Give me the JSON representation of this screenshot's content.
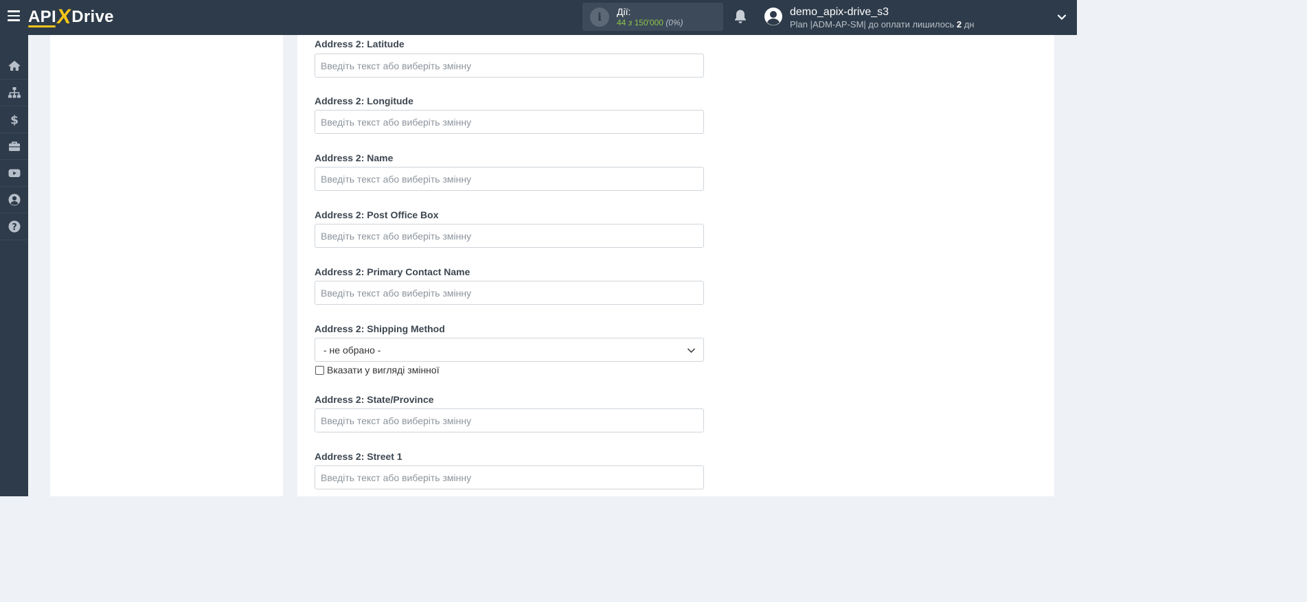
{
  "app": {
    "logo": {
      "left": "API",
      "mid": "X",
      "right": "Drive"
    }
  },
  "header": {
    "actions_title": "Дії:",
    "actions_used": "44",
    "actions_of": "з",
    "actions_total": "150'000",
    "actions_pct": "(0%)",
    "username": "demo_apix-drive_s3",
    "plan_prefix": "Plan |ADM-AP-SM| до оплати лишилось",
    "plan_days": "2",
    "plan_suffix": "дн",
    "accent_color": "#f5c518",
    "count_color": "#8bc34a"
  },
  "sidebar": {
    "items": [
      {
        "icon": "home-icon"
      },
      {
        "icon": "sitemap-icon"
      },
      {
        "icon": "dollar-icon"
      },
      {
        "icon": "briefcase-icon"
      },
      {
        "icon": "youtube-icon"
      },
      {
        "icon": "user-circle-icon"
      },
      {
        "icon": "question-circle-icon"
      }
    ]
  },
  "form": {
    "placeholder": "Введіть текст або виберіть змінну",
    "fields": [
      {
        "label": "Address 2: Latitude",
        "value": ""
      },
      {
        "label": "Address 2: Longitude",
        "value": ""
      },
      {
        "label": "Address 2: Name",
        "value": ""
      },
      {
        "label": "Address 2: Post Office Box",
        "value": ""
      },
      {
        "label": "Address 2: Primary Contact Name",
        "value": ""
      },
      {
        "label": "Address 2: Shipping Method",
        "selected": "- не обрано -",
        "checkbox_label": "Вказати у вигляді змінної",
        "checked": false
      },
      {
        "label": "Address 2: State/Province",
        "value": ""
      },
      {
        "label": "Address 2: Street 1",
        "value": ""
      }
    ]
  }
}
